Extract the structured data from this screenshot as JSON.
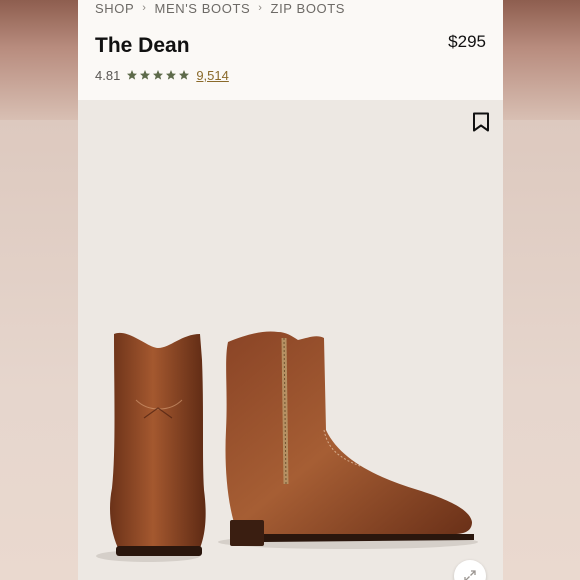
{
  "breadcrumb": {
    "items": [
      "SHOP",
      "MEN'S BOOTS",
      "ZIP BOOTS"
    ],
    "separator": "›"
  },
  "product": {
    "title": "The Dean",
    "price": "$295",
    "rating": "4.81",
    "stars": 5,
    "review_count": "9,514"
  },
  "icons": {
    "bookmark": "bookmark-icon",
    "expand": "expand-icon",
    "star": "star-icon"
  },
  "colors": {
    "star": "#5d6a4a",
    "reviews_link": "#8a6a2a",
    "boot_leather": "#8a4a2a"
  }
}
